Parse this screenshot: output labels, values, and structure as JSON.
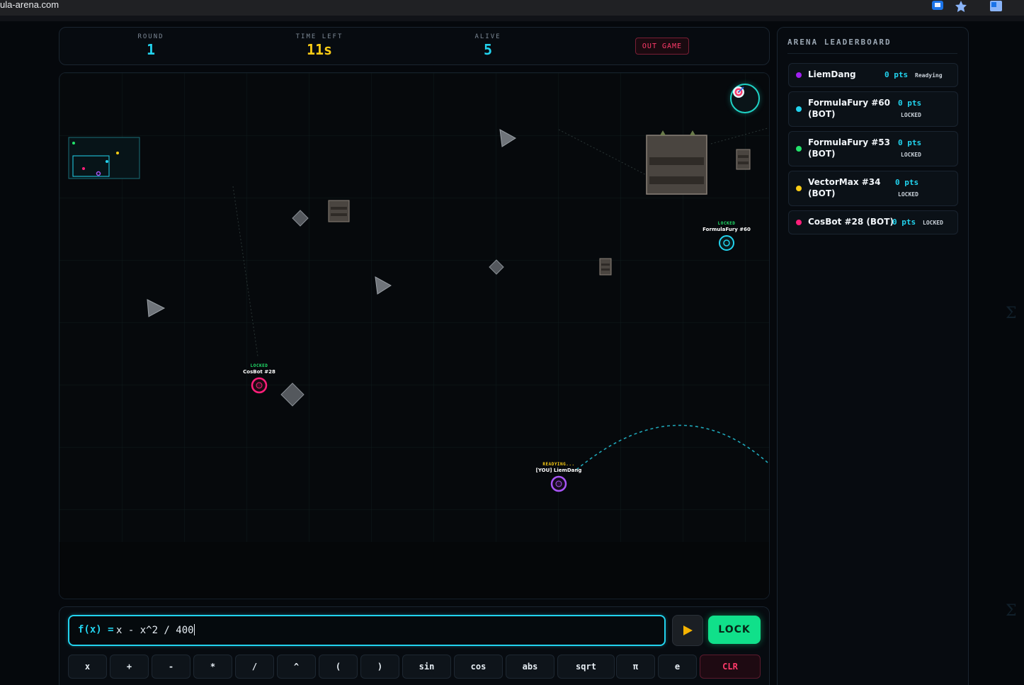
{
  "browser": {
    "url": "ula-arena.com"
  },
  "hud": {
    "round_label": "ROUND",
    "round_value": "1",
    "time_label": "TIME LEFT",
    "time_value": "11s",
    "alive_label": "ALIVE",
    "alive_value": "5",
    "out_game_label": "OUT GAME"
  },
  "arena": {
    "bots": [
      {
        "status": "LOCKED",
        "name": "FormulaFury #60",
        "color": "#22d3ee"
      },
      {
        "status": "LOCKED",
        "name": "CosBot #28",
        "color": "#ff1f7a"
      },
      {
        "status": "READYING...",
        "name": "[YOU] LiemDang",
        "color": "#a855f7"
      }
    ]
  },
  "leaderboard": {
    "title": "ARENA LEADERBOARD",
    "rows": [
      {
        "name": "LiemDang",
        "name2": "",
        "pts": "0 pts",
        "status": "Readying",
        "color": "#a020f0"
      },
      {
        "name": "FormulaFury #60",
        "name2": "(BOT)",
        "pts": "0 pts",
        "status": "LOCKED",
        "color": "#22d3ee"
      },
      {
        "name": "FormulaFury #53",
        "name2": "(BOT)",
        "pts": "0 pts",
        "status": "LOCKED",
        "color": "#22e36b"
      },
      {
        "name": "VectorMax #34",
        "name2": "(BOT)",
        "pts": "0 pts",
        "status": "LOCKED",
        "color": "#facc15"
      },
      {
        "name": "CosBot #28 (BOT)",
        "name2": "",
        "pts": "0 pts",
        "status": "LOCKED",
        "color": "#ff1f7a"
      }
    ]
  },
  "input": {
    "prefix": "f(x) =",
    "expression": "x - x^2 / 400",
    "lock_label": "LOCK",
    "keys": [
      "x",
      "+",
      "-",
      "*",
      "/",
      "^",
      "(",
      ")",
      "sin",
      "cos",
      "abs",
      "sqrt",
      "π",
      "e"
    ],
    "clear_label": "CLR"
  },
  "colors": {
    "accent": "#22d3ee",
    "lock": "#10e08a",
    "danger": "#ff3b6a",
    "time": "#facc15"
  }
}
